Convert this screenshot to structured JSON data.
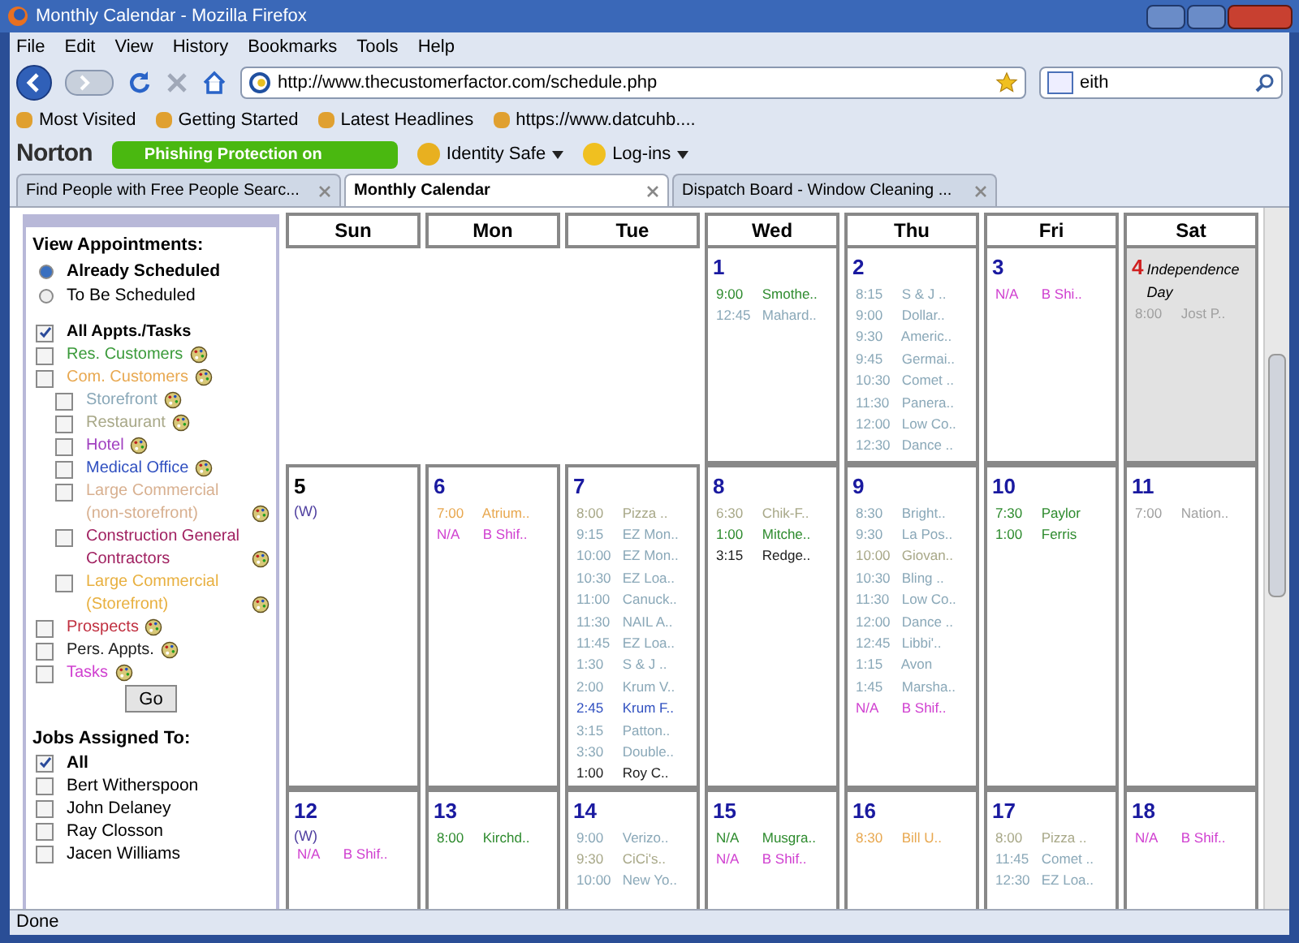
{
  "window": {
    "title": "Monthly Calendar - Mozilla Firefox"
  },
  "menu": [
    "File",
    "Edit",
    "View",
    "History",
    "Bookmarks",
    "Tools",
    "Help"
  ],
  "address": {
    "value": "http://www.thecustomerfactor.com/schedule.php"
  },
  "search": {
    "value": "eith"
  },
  "bookmarks": [
    "Most Visited",
    "Getting Started",
    "Latest Headlines",
    "https://www.datcuhb...."
  ],
  "norton": {
    "logo": "Norton",
    "phishing": "Phishing Protection on",
    "identity": "Identity Safe",
    "logins": "Log-ins"
  },
  "tabs": [
    {
      "label": "Find People with Free People Searc...",
      "selected": false
    },
    {
      "label": "Monthly Calendar",
      "selected": true
    },
    {
      "label": "Dispatch Board - Window Cleaning ...",
      "selected": false
    }
  ],
  "sidebar": {
    "view_title": "View Appointments:",
    "radios": [
      {
        "label": "Already Scheduled",
        "selected": true
      },
      {
        "label": "To Be Scheduled",
        "selected": false
      }
    ],
    "filters": [
      {
        "label": "All Appts./Tasks",
        "checked": true,
        "color": "#000000",
        "bold": true,
        "icon": false
      },
      {
        "label": "Res. Customers",
        "checked": false,
        "color": "#3a9a3a",
        "bold": false,
        "icon": true
      },
      {
        "label": "Com. Customers",
        "checked": false,
        "color": "#e8a850",
        "bold": false,
        "icon": true,
        "children": [
          {
            "label": "Storefront",
            "checked": false,
            "color": "#8aa8b8",
            "bold": false,
            "icon": true
          },
          {
            "label": "Restaurant",
            "checked": false,
            "color": "#a8a888",
            "bold": false,
            "icon": true
          },
          {
            "label": "Hotel",
            "checked": false,
            "color": "#a040c0",
            "bold": false,
            "icon": true
          },
          {
            "label": "Medical Office",
            "checked": false,
            "color": "#3050c0",
            "bold": false,
            "icon": true
          },
          {
            "label": "Large Commercial (non-storefront)",
            "checked": false,
            "color": "#d8b090",
            "bold": false,
            "icon": true
          },
          {
            "label": "Construction General Contractors",
            "checked": false,
            "color": "#a02060",
            "bold": false,
            "icon": true
          },
          {
            "label": "Large Commercial (Storefront)",
            "checked": false,
            "color": "#e8b040",
            "bold": false,
            "icon": true
          }
        ]
      },
      {
        "label": "Prospects",
        "checked": false,
        "color": "#c03040",
        "bold": false,
        "icon": true
      },
      {
        "label": "Pers. Appts.",
        "checked": false,
        "color": "#202020",
        "bold": false,
        "icon": true
      },
      {
        "label": "Tasks",
        "checked": false,
        "color": "#d040d0",
        "bold": false,
        "icon": true
      }
    ],
    "go": "Go",
    "jobs_title": "Jobs Assigned To:",
    "jobs": [
      {
        "label": "All",
        "checked": true
      },
      {
        "label": "Bert Witherspoon",
        "checked": false
      },
      {
        "label": "John Delaney",
        "checked": false
      },
      {
        "label": "Ray Closson",
        "checked": false
      },
      {
        "label": "Jacen Williams",
        "checked": false
      }
    ]
  },
  "calendar": {
    "weekdays": [
      "Sun",
      "Mon",
      "Tue",
      "Wed",
      "Thu",
      "Fri",
      "Sat"
    ],
    "weeks": [
      [
        {
          "kind": "empty"
        },
        {
          "kind": "empty"
        },
        {
          "kind": "empty"
        },
        {
          "kind": "day",
          "day": "1",
          "color": "#1a1aa0",
          "shaded": false,
          "events": [
            {
              "time": "9:00",
              "title": "Smothe..",
              "color": "#2e8b2e"
            },
            {
              "time": "12:45",
              "title": "Mahard..",
              "color": "#8aa8b8"
            }
          ]
        },
        {
          "kind": "day",
          "day": "2",
          "color": "#1a1aa0",
          "shaded": false,
          "events": [
            {
              "time": "8:15",
              "title": "S & J ..",
              "color": "#8aa8b8"
            },
            {
              "time": "9:00",
              "title": "Dollar..",
              "color": "#8aa8b8"
            },
            {
              "time": "9:30",
              "title": "Americ..",
              "color": "#8aa8b8"
            },
            {
              "time": "9:45",
              "title": "Germai..",
              "color": "#8aa8b8"
            },
            {
              "time": "10:30",
              "title": "Comet ..",
              "color": "#8aa8b8"
            },
            {
              "time": "11:30",
              "title": "Panera..",
              "color": "#8aa8b8"
            },
            {
              "time": "12:00",
              "title": "Low Co..",
              "color": "#8aa8b8"
            },
            {
              "time": "12:30",
              "title": "Dance ..",
              "color": "#8aa8b8"
            }
          ]
        },
        {
          "kind": "day",
          "day": "3",
          "color": "#1a1aa0",
          "shaded": false,
          "events": [
            {
              "time": "N/A",
              "title": "B Shi..",
              "color": "#d040d0"
            }
          ]
        },
        {
          "kind": "day",
          "day": "4",
          "color": "#d02020",
          "holiday": "Independence Day",
          "shaded": true,
          "events": [
            {
              "time": "8:00",
              "title": "Jost P..",
              "color": "#a0a0a0"
            }
          ]
        }
      ],
      [
        {
          "kind": "day",
          "day": "5",
          "color": "#000000",
          "note": "(W)",
          "shaded": false
        },
        {
          "kind": "day",
          "day": "6",
          "color": "#1a1aa0",
          "shaded": false,
          "events": [
            {
              "time": "7:00",
              "title": "Atrium..",
              "color": "#e8a850"
            },
            {
              "time": "N/A",
              "title": "B Shif..",
              "color": "#d040d0"
            }
          ]
        },
        {
          "kind": "day",
          "day": "7",
          "color": "#1a1aa0",
          "shaded": false,
          "events": [
            {
              "time": "8:00",
              "title": "Pizza ..",
              "color": "#a8a888"
            },
            {
              "time": "9:15",
              "title": "EZ Mon..",
              "color": "#8aa8b8"
            },
            {
              "time": "10:00",
              "title": "EZ Mon..",
              "color": "#8aa8b8"
            },
            {
              "time": "10:30",
              "title": "EZ Loa..",
              "color": "#8aa8b8"
            },
            {
              "time": "11:00",
              "title": "Canuck..",
              "color": "#8aa8b8"
            },
            {
              "time": "11:30",
              "title": "NAIL A..",
              "color": "#8aa8b8"
            },
            {
              "time": "11:45",
              "title": "EZ Loa..",
              "color": "#8aa8b8"
            },
            {
              "time": "1:30",
              "title": "S & J ..",
              "color": "#8aa8b8"
            },
            {
              "time": "2:00",
              "title": "Krum V..",
              "color": "#8aa8b8"
            },
            {
              "time": "2:45",
              "title": "Krum F..",
              "color": "#3050c0"
            },
            {
              "time": "3:15",
              "title": "Patton..",
              "color": "#8aa8b8"
            },
            {
              "time": "3:30",
              "title": "Double..",
              "color": "#8aa8b8"
            },
            {
              "time": "1:00",
              "title": "Roy C..",
              "color": "#202020"
            }
          ]
        },
        {
          "kind": "day",
          "day": "8",
          "color": "#1a1aa0",
          "shaded": false,
          "events": [
            {
              "time": "6:30",
              "title": "Chik-F..",
              "color": "#a8a888"
            },
            {
              "time": "1:00",
              "title": "Mitche..",
              "color": "#2e8b2e"
            },
            {
              "time": "3:15",
              "title": "Redge..",
              "color": "#202020"
            }
          ]
        },
        {
          "kind": "day",
          "day": "9",
          "color": "#1a1aa0",
          "shaded": false,
          "events": [
            {
              "time": "8:30",
              "title": "Bright..",
              "color": "#8aa8b8"
            },
            {
              "time": "9:30",
              "title": "La Pos..",
              "color": "#8aa8b8"
            },
            {
              "time": "10:00",
              "title": "Giovan..",
              "color": "#a8a888"
            },
            {
              "time": "10:30",
              "title": "Bling ..",
              "color": "#8aa8b8"
            },
            {
              "time": "11:30",
              "title": "Low Co..",
              "color": "#8aa8b8"
            },
            {
              "time": "12:00",
              "title": "Dance ..",
              "color": "#8aa8b8"
            },
            {
              "time": "12:45",
              "title": "Libbi'..",
              "color": "#8aa8b8"
            },
            {
              "time": "1:15",
              "title": "Avon",
              "color": "#8aa8b8"
            },
            {
              "time": "1:45",
              "title": "Marsha..",
              "color": "#8aa8b8"
            },
            {
              "time": "N/A",
              "title": "B Shif..",
              "color": "#d040d0"
            }
          ]
        },
        {
          "kind": "day",
          "day": "10",
          "color": "#1a1aa0",
          "shaded": false,
          "events": [
            {
              "time": "7:30",
              "title": "Paylor",
              "color": "#2e8b2e"
            },
            {
              "time": "1:00",
              "title": "Ferris",
              "color": "#2e8b2e"
            }
          ]
        },
        {
          "kind": "day",
          "day": "11",
          "color": "#1a1aa0",
          "shaded": false,
          "events": [
            {
              "time": "7:00",
              "title": "Nation..",
              "color": "#a0a0a0"
            }
          ]
        }
      ],
      [
        {
          "kind": "day",
          "day": "12",
          "color": "#1a1aa0",
          "note": "(W)",
          "shaded": false,
          "events": [
            {
              "time": "N/A",
              "title": "B Shif..",
              "color": "#d040d0"
            }
          ]
        },
        {
          "kind": "day",
          "day": "13",
          "color": "#1a1aa0",
          "shaded": false,
          "events": [
            {
              "time": "8:00",
              "title": "Kirchd..",
              "color": "#2e8b2e"
            }
          ]
        },
        {
          "kind": "day",
          "day": "14",
          "color": "#1a1aa0",
          "shaded": false,
          "events": [
            {
              "time": "9:00",
              "title": "Verizo..",
              "color": "#8aa8b8"
            },
            {
              "time": "9:30",
              "title": "CiCi's..",
              "color": "#a8a888"
            },
            {
              "time": "10:00",
              "title": "New Yo..",
              "color": "#8aa8b8"
            }
          ]
        },
        {
          "kind": "day",
          "day": "15",
          "color": "#1a1aa0",
          "shaded": false,
          "events": [
            {
              "time": "N/A",
              "title": "Musgra..",
              "color": "#2e8b2e"
            },
            {
              "time": "N/A",
              "title": "B Shif..",
              "color": "#d040d0"
            }
          ]
        },
        {
          "kind": "day",
          "day": "16",
          "color": "#1a1aa0",
          "shaded": false,
          "events": [
            {
              "time": "8:30",
              "title": "Bill U..",
              "color": "#e8a850"
            }
          ]
        },
        {
          "kind": "day",
          "day": "17",
          "color": "#1a1aa0",
          "shaded": false,
          "events": [
            {
              "time": "8:00",
              "title": "Pizza ..",
              "color": "#a8a888"
            },
            {
              "time": "11:45",
              "title": "Comet ..",
              "color": "#8aa8b8"
            },
            {
              "time": "12:30",
              "title": "EZ Loa..",
              "color": "#8aa8b8"
            }
          ]
        },
        {
          "kind": "day",
          "day": "18",
          "color": "#1a1aa0",
          "shaded": false,
          "events": [
            {
              "time": "N/A",
              "title": "B Shif..",
              "color": "#d040d0"
            }
          ]
        }
      ]
    ]
  },
  "status_bar": {
    "text": "Done"
  }
}
